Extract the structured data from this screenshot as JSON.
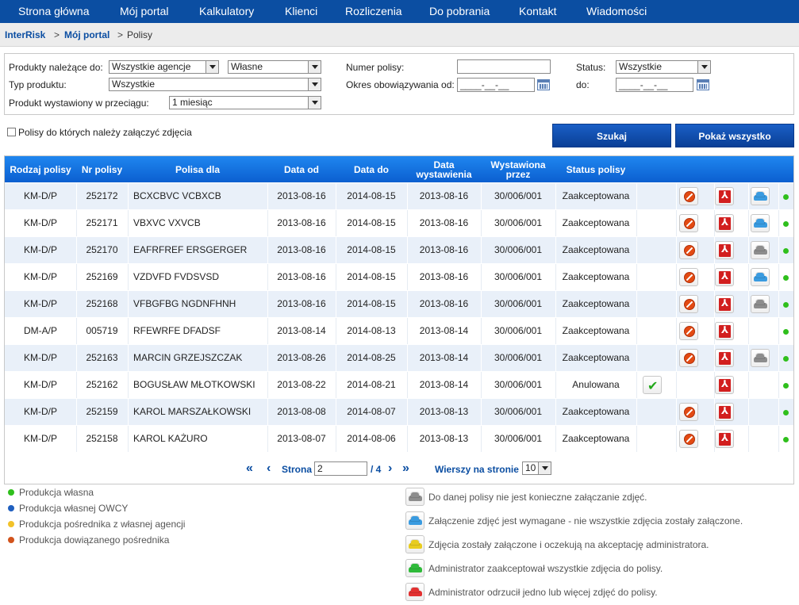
{
  "nav": [
    "Strona główna",
    "Mój portal",
    "Kalkulatory",
    "Klienci",
    "Rozliczenia",
    "Do pobrania",
    "Kontakt",
    "Wiadomości"
  ],
  "breadcrumb": {
    "root": "InterRisk",
    "portal": "Mój portal",
    "current": "Polisy",
    "sep": ">"
  },
  "filters": {
    "products_owner_label": "Produkty należące do:",
    "agency_value": "Wszystkie agencje",
    "own_value": "Własne",
    "product_type_label": "Typ produktu:",
    "product_type_value": "Wszystkie",
    "issued_within_label": "Produkt wystawiony w przeciągu:",
    "issued_within_value": "1 miesiąc",
    "policy_number_label": "Numer polisy:",
    "policy_number_value": "",
    "validity_from_label": "Okres obowiązywania od:",
    "date_placeholder": "____-__-__",
    "status_label": "Status:",
    "status_value": "Wszystkie",
    "to_label": "do:"
  },
  "photos_checkbox_label": "Polisy do których należy załączyć zdjęcia",
  "buttons": {
    "search": "Szukaj",
    "show_all": "Pokaż wszystko"
  },
  "table": {
    "headers": [
      "Rodzaj polisy",
      "Nr polisy",
      "Polisa dla",
      "Data od",
      "Data do",
      "Data wystawienia",
      "Wystawiona przez",
      "Status polisy"
    ],
    "rows": [
      {
        "type": "KM-D/P",
        "number": "252172",
        "holder": "BCXCBVC VCBXCB",
        "from": "2013-08-16",
        "to": "2014-08-15",
        "issued": "2013-08-16",
        "issuer": "30/006/001",
        "status": "Zaakceptowana",
        "car": "blue"
      },
      {
        "type": "KM-D/P",
        "number": "252171",
        "holder": "VBXVC VXVCB",
        "from": "2013-08-16",
        "to": "2014-08-15",
        "issued": "2013-08-16",
        "issuer": "30/006/001",
        "status": "Zaakceptowana",
        "car": "blue"
      },
      {
        "type": "KM-D/P",
        "number": "252170",
        "holder": "EAFRFREF ERSGERGER",
        "from": "2013-08-16",
        "to": "2014-08-15",
        "issued": "2013-08-16",
        "issuer": "30/006/001",
        "status": "Zaakceptowana",
        "car": "gray"
      },
      {
        "type": "KM-D/P",
        "number": "252169",
        "holder": "VZDVFD FVDSVSD",
        "from": "2013-08-16",
        "to": "2014-08-15",
        "issued": "2013-08-16",
        "issuer": "30/006/001",
        "status": "Zaakceptowana",
        "car": "blue"
      },
      {
        "type": "KM-D/P",
        "number": "252168",
        "holder": "VFBGFBG NGDNFHNH",
        "from": "2013-08-16",
        "to": "2014-08-15",
        "issued": "2013-08-16",
        "issuer": "30/006/001",
        "status": "Zaakceptowana",
        "car": "gray"
      },
      {
        "type": "DM-A/P",
        "number": "005719",
        "holder": "RFEWRFE DFADSF",
        "from": "2013-08-14",
        "to": "2014-08-13",
        "issued": "2013-08-14",
        "issuer": "30/006/001",
        "status": "Zaakceptowana",
        "car": "none"
      },
      {
        "type": "KM-D/P",
        "number": "252163",
        "holder": "MARCIN GRZEJSZCZAK",
        "from": "2013-08-26",
        "to": "2014-08-25",
        "issued": "2013-08-14",
        "issuer": "30/006/001",
        "status": "Zaakceptowana",
        "car": "gray"
      },
      {
        "type": "KM-D/P",
        "number": "252162",
        "holder": "BOGUSŁAW MŁOTKOWSKI",
        "from": "2013-08-22",
        "to": "2014-08-21",
        "issued": "2013-08-14",
        "issuer": "30/006/001",
        "status": "Anulowana",
        "car": "none",
        "cancelled": true
      },
      {
        "type": "KM-D/P",
        "number": "252159",
        "holder": "KAROL MARSZAŁKOWSKI",
        "from": "2013-08-08",
        "to": "2014-08-07",
        "issued": "2013-08-13",
        "issuer": "30/006/001",
        "status": "Zaakceptowana",
        "car": "none",
        "shift": true
      },
      {
        "type": "KM-D/P",
        "number": "252158",
        "holder": "KAROL KAŻURO",
        "from": "2013-08-07",
        "to": "2014-08-06",
        "issued": "2013-08-13",
        "issuer": "30/006/001",
        "status": "Zaakceptowana",
        "car": "none",
        "shift": true
      }
    ]
  },
  "pager": {
    "page_label": "Strona",
    "page_value": "2",
    "total": "/ 4",
    "rows_label": "Wierszy na stronie",
    "rows_value": "10"
  },
  "legend_dots": [
    {
      "label": "Produkcja własna",
      "color": "#2fbf1c"
    },
    {
      "label": "Produkcja własnej OWCY",
      "color": "#1f5fbf"
    },
    {
      "label": "Produkcja pośrednika z własnej agencji",
      "color": "#f2c229"
    },
    {
      "label": "Produkcja dowiązanego pośrednika",
      "color": "#d2531c"
    }
  ],
  "legend_cars": [
    {
      "label": "Do danej polisy nie jest konieczne załączanie zdjęć.",
      "color": "#8d8d8d"
    },
    {
      "label": "Załączenie zdjęć jest wymagane - nie wszystkie zdjęcia zostały załączone.",
      "color": "#3a9be0"
    },
    {
      "label": "Zdjęcia zostały załączone i oczekują na akceptację administratora.",
      "color": "#e8cc1f"
    },
    {
      "label": "Administrator zaakceptował wszystkie zdjęcia do polisy.",
      "color": "#2fba3a"
    },
    {
      "label": "Administrator odrzucił jedno lub więcej zdjęć do polisy.",
      "color": "#e23030"
    }
  ],
  "colors": {
    "nav_bg": "#0b4ea2",
    "header_bg": "#1f86ef",
    "row_alt": "#e9f0f9",
    "status_dot": "#2fbf1c",
    "car_blue": "#3a9be0",
    "car_gray": "#8d8d8d"
  }
}
